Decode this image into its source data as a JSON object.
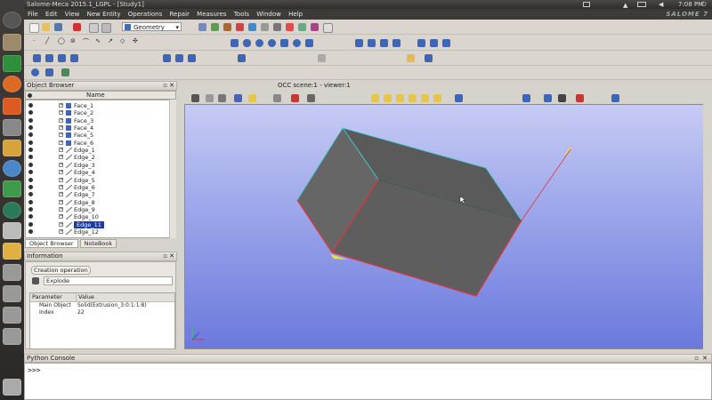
{
  "window": {
    "title": "Salome-Meca 2015.1_LGPL - [Study1]",
    "time": "7:08 PM",
    "brand": "SALOME 7"
  },
  "menu": [
    "File",
    "Edit",
    "View",
    "New Entity",
    "Operations",
    "Repair",
    "Measures",
    "Tools",
    "Window",
    "Help"
  ],
  "toolbar": {
    "module_select": "Geometry"
  },
  "object_browser": {
    "title": "Object Browser",
    "column": "Name",
    "items": [
      {
        "label": "Face_1",
        "kind": "face"
      },
      {
        "label": "Face_2",
        "kind": "face"
      },
      {
        "label": "Face_3",
        "kind": "face"
      },
      {
        "label": "Face_4",
        "kind": "face"
      },
      {
        "label": "Face_5",
        "kind": "face"
      },
      {
        "label": "Face_6",
        "kind": "face"
      },
      {
        "label": "Edge_1",
        "kind": "edge"
      },
      {
        "label": "Edge_2",
        "kind": "edge"
      },
      {
        "label": "Edge_3",
        "kind": "edge"
      },
      {
        "label": "Edge_4",
        "kind": "edge"
      },
      {
        "label": "Edge_5",
        "kind": "edge"
      },
      {
        "label": "Edge_6",
        "kind": "edge"
      },
      {
        "label": "Edge_7",
        "kind": "edge"
      },
      {
        "label": "Edge_8",
        "kind": "edge"
      },
      {
        "label": "Edge_9",
        "kind": "edge"
      },
      {
        "label": "Edge_10",
        "kind": "edge"
      },
      {
        "label": "Edge_11",
        "kind": "edge",
        "selected": true
      },
      {
        "label": "Edge_12",
        "kind": "edge"
      }
    ],
    "tabs": [
      "Object Browser",
      "NoteBook"
    ]
  },
  "information": {
    "title": "Information",
    "section": "Creation operation",
    "operation": "Explode",
    "headers": [
      "Parameter",
      "Value"
    ],
    "rows": [
      {
        "param": "Main Object",
        "value": "Solid(Extrusion_3:0:1:1:8)"
      },
      {
        "param": "Index",
        "value": "22"
      }
    ]
  },
  "viewer": {
    "title": "OCC scene:1 - viewer:1"
  },
  "console": {
    "title": "Python Console",
    "prompt": ">>>"
  },
  "colors": {
    "viewport_top": "#c6cbf4",
    "viewport_bottom": "#6b79dd",
    "solid": "#5f5f5f",
    "selected_edge": "#e0353a",
    "highlight_edge": "#3fd1cc"
  }
}
